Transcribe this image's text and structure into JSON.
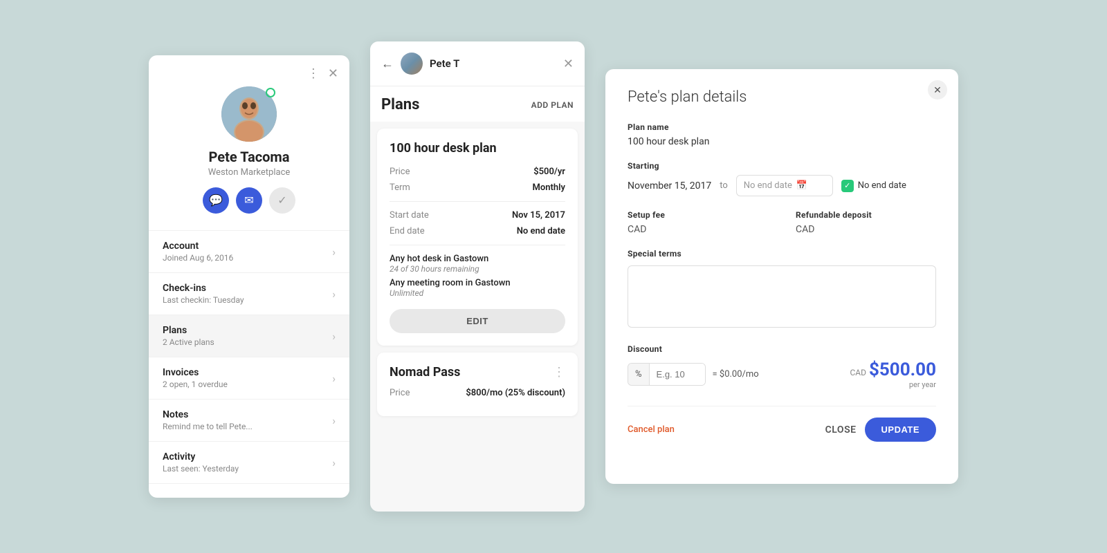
{
  "profile": {
    "name": "Pete Tacoma",
    "org": "Weston Marketplace",
    "status": "online",
    "actions": {
      "chat": "💬",
      "email": "✉",
      "check": "✓"
    },
    "nav": [
      {
        "id": "account",
        "label": "Account",
        "sub": "Joined Aug 6, 2016",
        "active": false
      },
      {
        "id": "checkins",
        "label": "Check-ins",
        "sub": "Last checkin: Tuesday",
        "active": false
      },
      {
        "id": "plans",
        "label": "Plans",
        "sub": "2 Active plans",
        "active": true
      },
      {
        "id": "invoices",
        "label": "Invoices",
        "sub": "2 open, 1 overdue",
        "active": false
      },
      {
        "id": "notes",
        "label": "Notes",
        "sub": "Remind me to tell Pete...",
        "active": false
      },
      {
        "id": "activity",
        "label": "Activity",
        "sub": "Last seen: Yesterday",
        "active": false
      }
    ]
  },
  "plans_panel": {
    "header_user": "Pete T",
    "title": "Plans",
    "add_plan_label": "ADD PLAN",
    "plan1": {
      "title": "100 hour desk plan",
      "price_label": "Price",
      "price": "$500/yr",
      "term_label": "Term",
      "term": "Monthly",
      "start_date_label": "Start date",
      "start_date": "Nov 15, 2017",
      "end_date_label": "End date",
      "end_date": "No end date",
      "resources": [
        {
          "name": "Any hot desk in Gastown",
          "sub": "24 of 30 hours remaining"
        },
        {
          "name": "Any meeting room in Gastown",
          "sub": "Unlimited"
        }
      ],
      "edit_label": "EDIT"
    },
    "plan2": {
      "title": "Nomad Pass",
      "price_label": "Price",
      "price": "$800/mo (25% discount)"
    }
  },
  "plan_details": {
    "title": "Pete's plan details",
    "plan_name_label": "Plan name",
    "plan_name": "100 hour desk plan",
    "starting_label": "Starting",
    "starting_date": "November 15, 2017",
    "to_label": "to",
    "no_end_date_placeholder": "No end date",
    "no_end_date_label": "No end date",
    "setup_fee_label": "Setup fee",
    "setup_fee_currency": "CAD",
    "refundable_deposit_label": "Refundable deposit",
    "refundable_deposit_currency": "CAD",
    "special_terms_label": "Special terms",
    "special_terms_placeholder": "",
    "discount_label": "Discount",
    "discount_prefix": "%",
    "discount_placeholder": "E.g. 10",
    "discount_monthly": "= $0.00/mo",
    "price_currency": "CAD",
    "price_amount": "$500.00",
    "price_period": "per year",
    "cancel_plan_label": "Cancel plan",
    "close_label": "CLOSE",
    "update_label": "UPDATE"
  }
}
